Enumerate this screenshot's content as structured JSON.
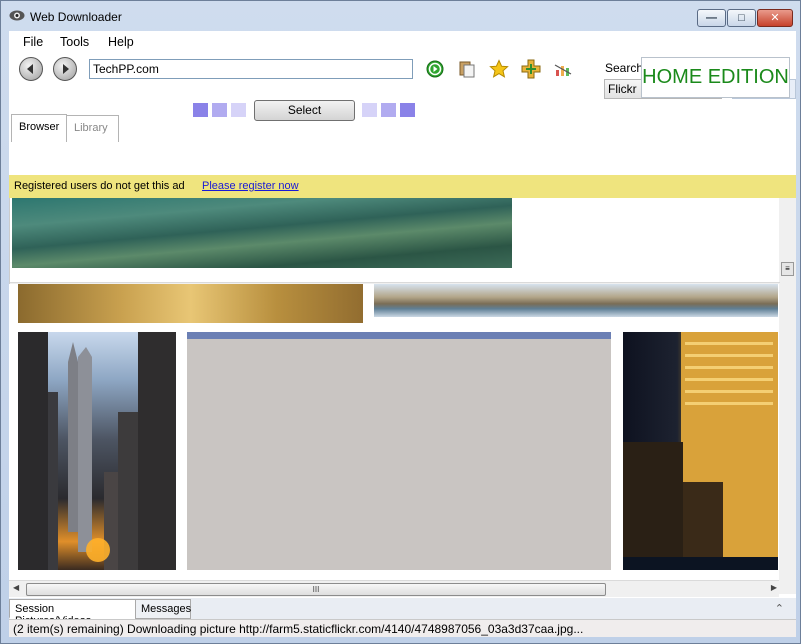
{
  "window": {
    "title": "Web Downloader",
    "icon": "downloader-eye-icon"
  },
  "menubar": {
    "items": [
      "File",
      "Tools",
      "Help"
    ]
  },
  "toolbar": {
    "back_icon": "back-arrow-icon",
    "forward_icon": "forward-arrow-icon",
    "url_value": "TechPP.com",
    "icons": [
      "go-icon",
      "clipboard-icon",
      "favorites-star-icon",
      "add-site-icon",
      "ranking-icon"
    ],
    "search_label": "Search",
    "source_select_value": "Flickr Images",
    "home_edition": "HOME EDITION",
    "select_label": "Select"
  },
  "tabs": {
    "browser": "Browser",
    "library": "Library"
  },
  "adbar": {
    "text": "Registered users do not get this ad",
    "link": "Please register now",
    "color": "#efe47e"
  },
  "gallery": {
    "images": [
      "sea-image",
      "amber-city-image",
      "harbor-skyline-image",
      "empire-state-street-image",
      "loading-placeholder-image",
      "night-skyscraper-image"
    ]
  },
  "bottom_tabs": {
    "session": "Session Pictures/Videos",
    "messages": "Messages"
  },
  "status": {
    "text": "(2 item(s) remaining) Downloading picture http://farm5.staticflickr.com/4140/4748987056_03a3d37caa.jpg..."
  },
  "colors": {
    "accent_green": "#1b8a1b",
    "link_blue": "#1a1ad6",
    "selector_dark": "#8a82e8",
    "selector_light": "#d6d3f8"
  }
}
